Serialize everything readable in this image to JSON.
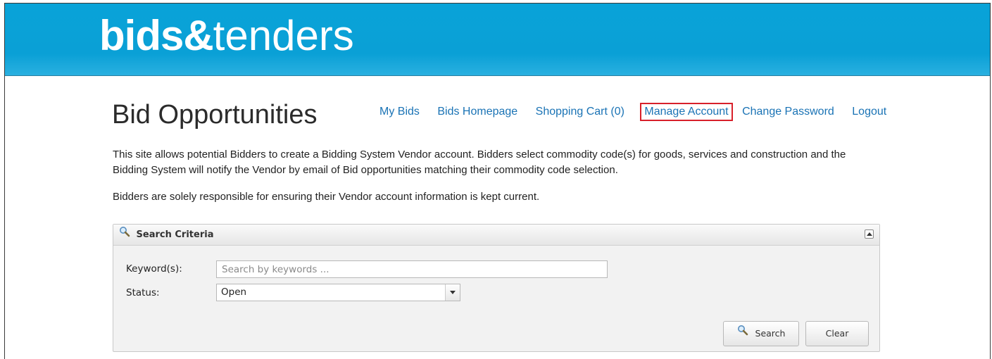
{
  "header": {
    "logo_bold": "bids&",
    "logo_light": "tenders",
    "background_color": "#0aa0d6"
  },
  "page": {
    "title": "Bid Opportunities"
  },
  "nav": {
    "my_bids": "My Bids",
    "bids_homepage": "Bids Homepage",
    "shopping_cart": "Shopping Cart (0)",
    "manage_account": "Manage Account",
    "change_password": "Change Password",
    "logout": "Logout",
    "highlight_color": "#d8202a"
  },
  "intro": {
    "paragraph1": "This site allows potential Bidders to create a Bidding System Vendor account. Bidders select commodity code(s) for goods, services and construction and the Bidding System will notify the Vendor by email of Bid opportunities matching their commodity code selection.",
    "paragraph2": "Bidders are solely responsible for ensuring their Vendor account information is kept current."
  },
  "search_panel": {
    "title": "Search Criteria",
    "keyword_label": "Keyword(s):",
    "keyword_placeholder": "Search by keywords ...",
    "keyword_value": "",
    "status_label": "Status:",
    "status_value": "Open",
    "search_button": "Search",
    "clear_button": "Clear",
    "icons": {
      "title": "magnifier-icon",
      "collapse": "collapse-up-icon",
      "search_button": "magnifier-icon"
    }
  }
}
